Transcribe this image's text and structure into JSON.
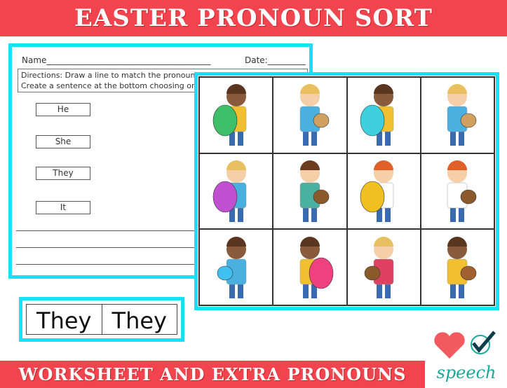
{
  "header": {
    "title": "EASTER PRONOUN SORT"
  },
  "footer": {
    "title": "WORKSHEET AND EXTRA PRONOUNS"
  },
  "worksheet": {
    "name_label": "Name_______________________________________",
    "date_label": "Date:_________",
    "directions_line1": "Directions: Draw a line to match the pronoun to",
    "directions_line2": "Create a sentence at the bottom choosing one",
    "pronouns": [
      "He",
      "She",
      "They",
      "It"
    ]
  },
  "picture_cards": [
    "boy-with-egg",
    "boy-with-basket",
    "girls-with-eggs",
    "boy-with-basket",
    "boy-with-egg",
    "girl-with-basket",
    "girl-with-egg",
    "girl-with-basket",
    "kids-with-sign",
    "girl-with-egg",
    "kids-at-table",
    "boy-with-basket"
  ],
  "extra_pronouns": [
    "They",
    "They"
  ],
  "logo": {
    "text": "speech",
    "icons": [
      "heart-icon",
      "check-icon"
    ]
  },
  "colors": {
    "accent_red": "#f2444f",
    "border_cyan": "#17e0f7",
    "logo_teal": "#1aa89a"
  }
}
